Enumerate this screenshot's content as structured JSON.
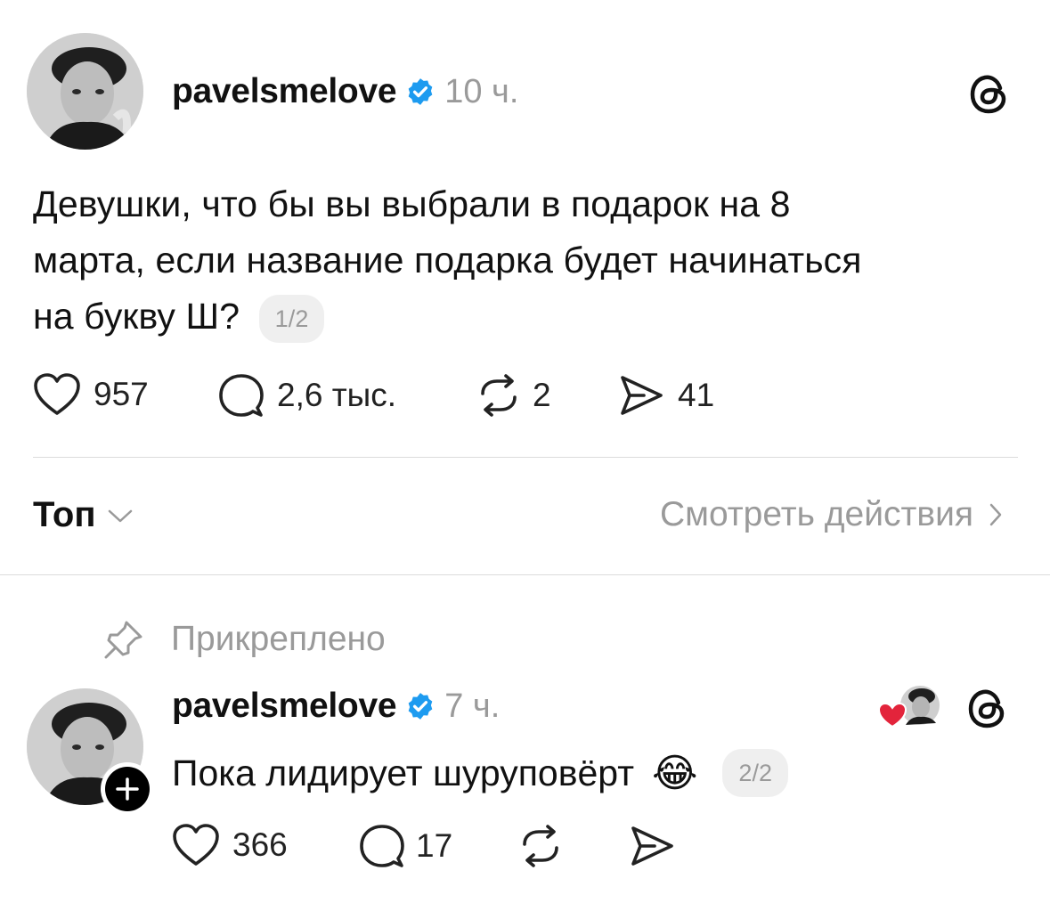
{
  "post": {
    "username": "pavelsmelove",
    "time": "10 ч.",
    "text_line1": "Девушки, что бы вы выбрали в подарок на 8",
    "text_line2": "марта, если название подарка будет начинаться",
    "text_line3": "на букву Ш?",
    "pager": "1/2",
    "likes": "957",
    "replies": "2,6 тыс.",
    "reposts": "2",
    "shares": "41"
  },
  "sort": {
    "label": "Топ",
    "activity_link": "Смотреть действия"
  },
  "reply": {
    "pinned_label": "Прикреплено",
    "username": "pavelsmelove",
    "time": "7 ч.",
    "text": "Пока лидирует шуруповёрт",
    "emoji": "😂",
    "pager": "2/2",
    "likes": "366",
    "replies": "17"
  },
  "colors": {
    "verified": "#1d9bf0",
    "heart_badge": "#e3243b",
    "secondary_text": "#9a9a9a"
  },
  "icons": [
    "threads-logo-icon",
    "verified-badge-icon",
    "heart-icon",
    "comment-icon",
    "repost-icon",
    "share-icon",
    "chevron-down-icon",
    "chevron-right-icon",
    "pin-icon",
    "follow-plus-icon",
    "liked-by-author-icon"
  ]
}
